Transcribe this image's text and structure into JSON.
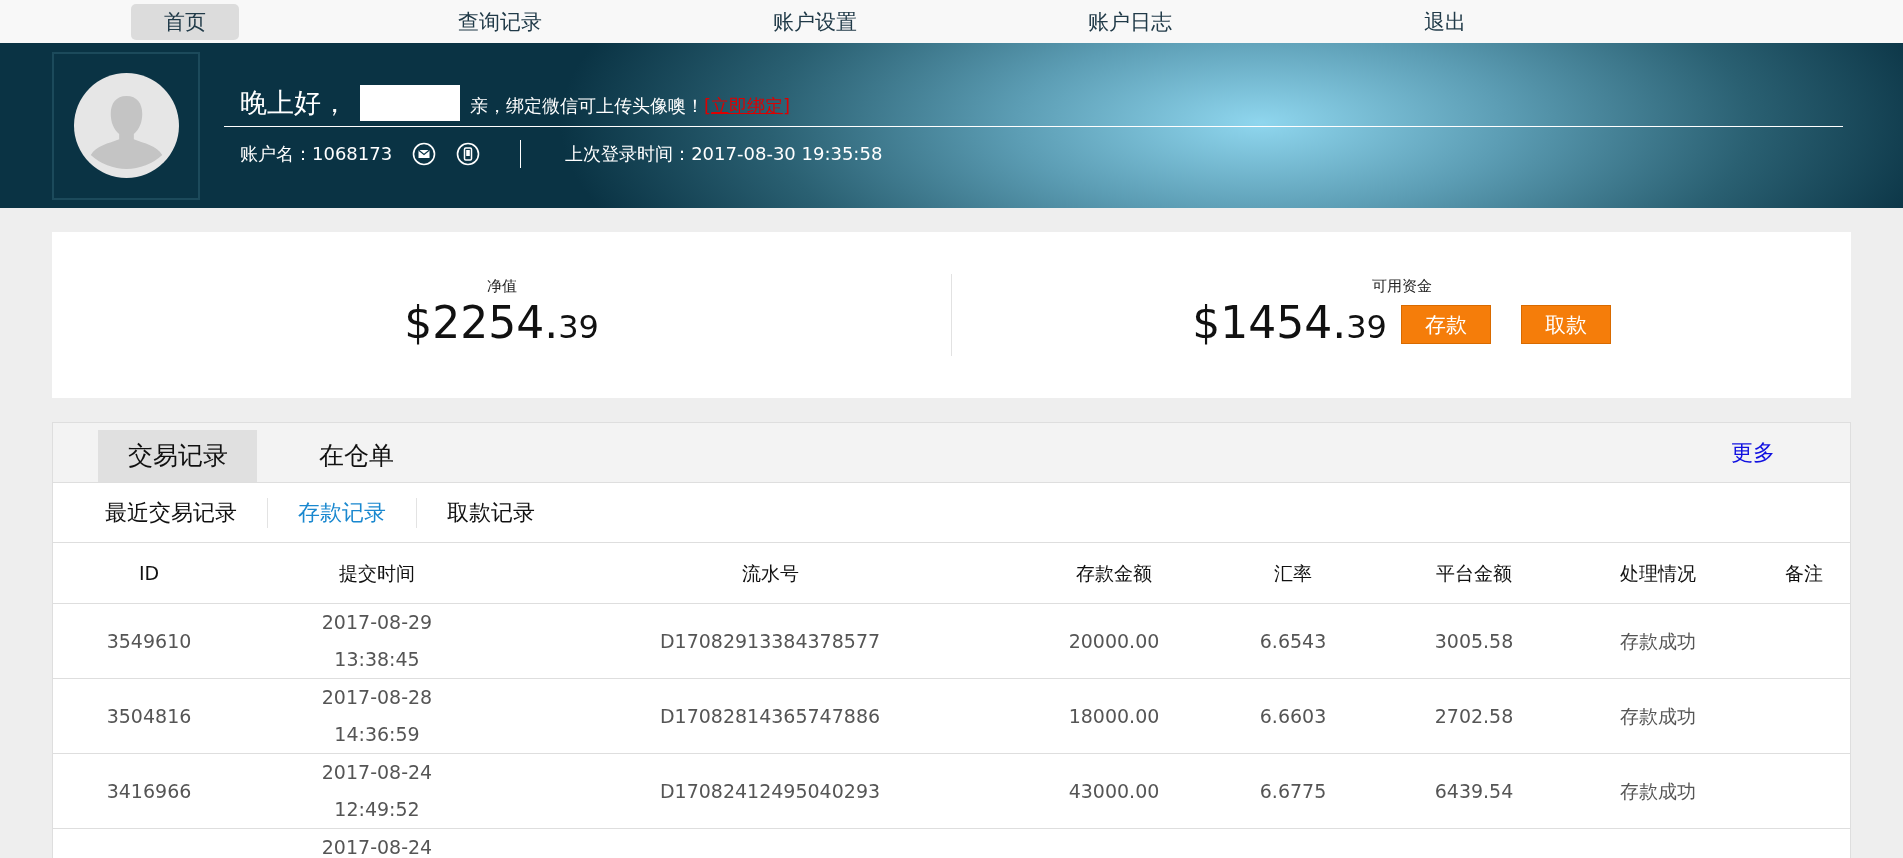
{
  "nav": [
    {
      "label": "首页",
      "selected": true
    },
    {
      "label": "查询记录",
      "selected": false
    },
    {
      "label": "账户设置",
      "selected": false
    },
    {
      "label": "账户日志",
      "selected": false
    },
    {
      "label": "退出",
      "selected": false
    }
  ],
  "profile": {
    "greeting": "晚上好，",
    "name_redacted": true,
    "bind_hint": "亲，绑定微信可上传头像噢！",
    "bind_link": "[立即绑定]",
    "account": "账户名：1068173",
    "last_login": "上次登录时间：2017-08-30 19:35:58"
  },
  "balances": [
    {
      "label": "净值",
      "whole": "$2254.",
      "cents": "39"
    },
    {
      "label": "可用资金",
      "whole": "$1454.",
      "cents": "39",
      "buttons": [
        "存款",
        "取款"
      ]
    }
  ],
  "tabs": [
    {
      "label": "交易记录",
      "selected": true
    },
    {
      "label": "在仓单",
      "selected": false
    }
  ],
  "more_link": "更多",
  "subtabs": [
    {
      "label": "最近交易记录",
      "selected": false
    },
    {
      "label": "存款记录",
      "selected": true
    },
    {
      "label": "取款记录",
      "selected": false
    }
  ],
  "table": {
    "columns": [
      "ID",
      "提交时间",
      "流水号",
      "存款金额",
      "汇率",
      "平台金额",
      "处理情况",
      "备注"
    ],
    "rows": [
      {
        "cells": [
          "3549610",
          "2017-08-29\n13:38:45",
          "D17082913384378577",
          "20000.00",
          "6.6543",
          "3005.58",
          "存款成功",
          ""
        ]
      },
      {
        "cells": [
          "3504816",
          "2017-08-28\n14:36:59",
          "D17082814365747886",
          "18000.00",
          "6.6603",
          "2702.58",
          "存款成功",
          ""
        ]
      },
      {
        "cells": [
          "3416966",
          "2017-08-24\n12:49:52",
          "D17082412495040293",
          "43000.00",
          "6.6775",
          "6439.54",
          "存款成功",
          ""
        ]
      },
      {
        "cells": [
          "",
          "2017-08-24",
          "",
          "",
          "",
          "",
          "",
          ""
        ]
      }
    ]
  }
}
